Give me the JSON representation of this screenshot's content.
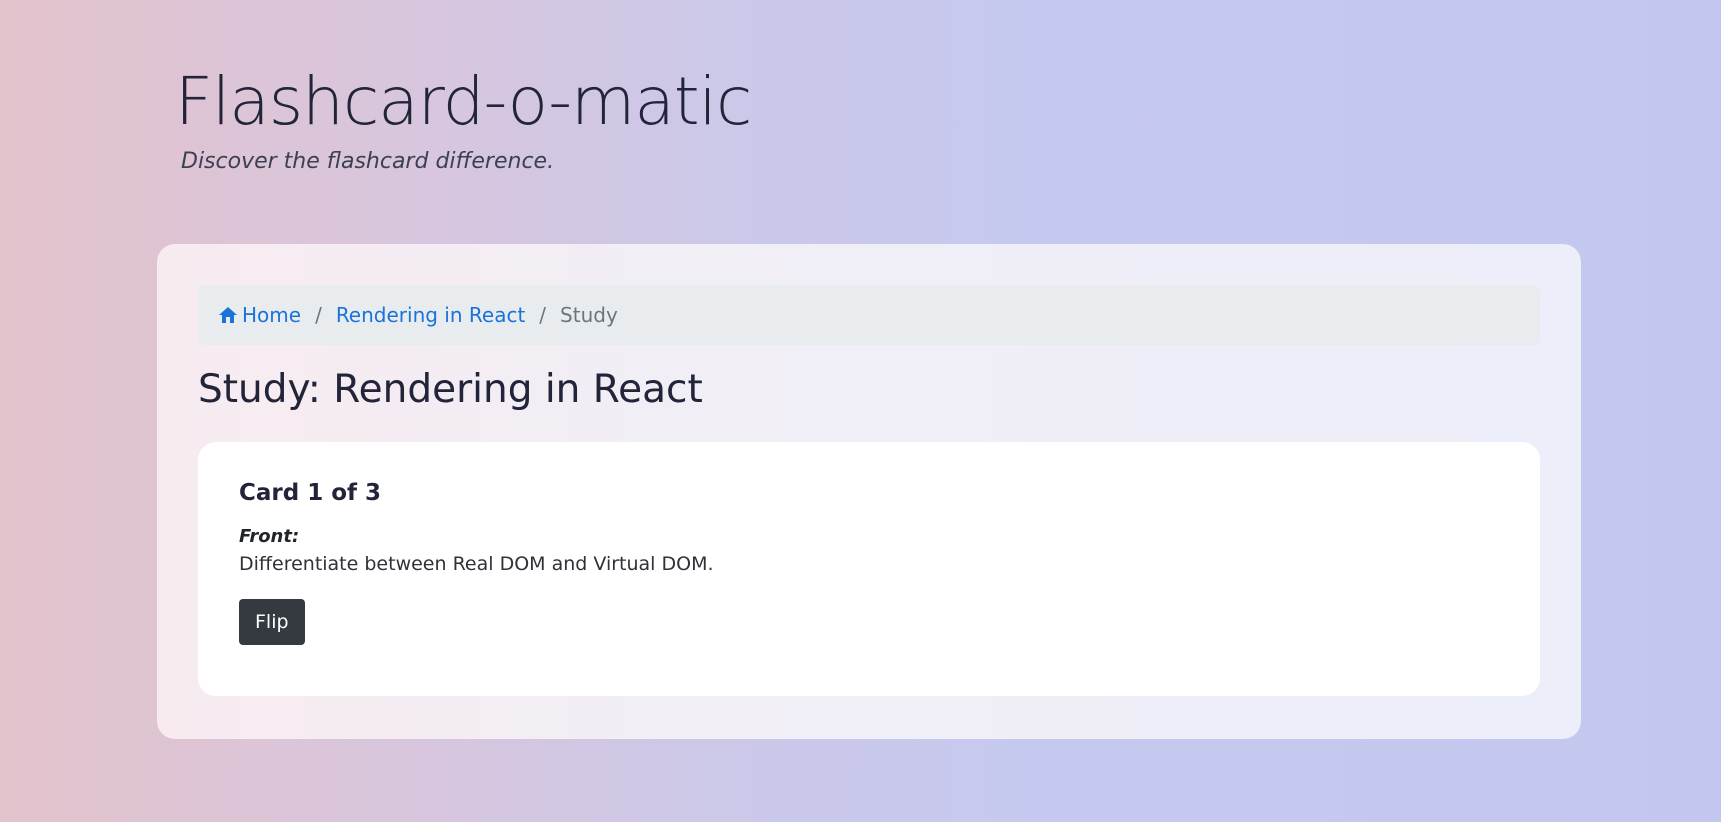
{
  "header": {
    "title": "Flashcard-o-matic",
    "tagline": "Discover the flashcard difference."
  },
  "breadcrumb": {
    "items": [
      {
        "label": "Home",
        "icon": "home-icon",
        "link": true
      },
      {
        "label": "Rendering in React",
        "link": true
      },
      {
        "label": "Study",
        "link": false
      }
    ],
    "separator": "/"
  },
  "main": {
    "title": "Study: Rendering in React",
    "card": {
      "count": "Card 1 of 3",
      "front_label": "Front:",
      "front_text": "Differentiate between Real DOM and Virtual DOM.",
      "flip_label": "Flip"
    }
  },
  "colors": {
    "link": "#1a73d9",
    "button": "#343a40",
    "breadcrumb_bg": "#e9ecef"
  }
}
